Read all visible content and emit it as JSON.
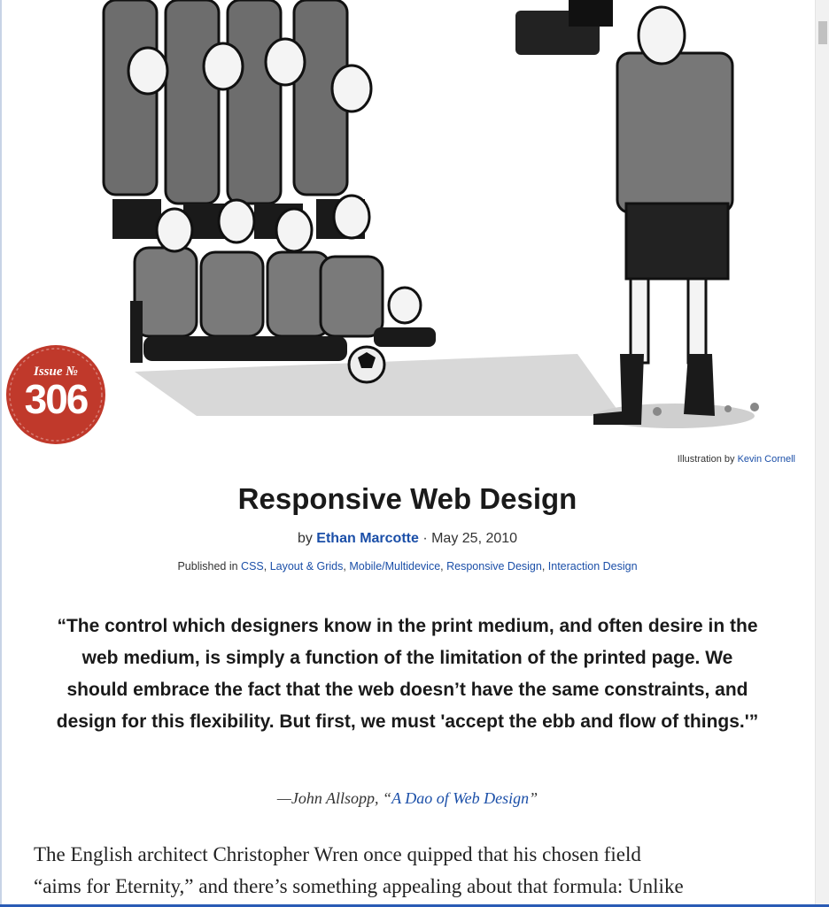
{
  "illustration": {
    "credit_prefix": "Illustration by",
    "credit_author": "Kevin Cornell"
  },
  "badge": {
    "issue_label": "Issue №",
    "number": "306",
    "color": "#c0392b"
  },
  "article": {
    "title": "Responsive Web Design",
    "by_prefix": "by",
    "author": "Ethan Marcotte",
    "date": "· May 25, 2010",
    "published_prefix": "Published in",
    "categories": [
      "CSS",
      "Layout & Grids",
      "Mobile/Multidevice",
      "Responsive Design",
      "Interaction Design"
    ],
    "pullquote": "“The control which designers know in the print medium, and often desire in the web medium, is simply a function of the limitation of the printed page. We should embrace the fact that the web doesn’t have the same constraints, and design for this flexibility. But first, we must 'accept the ebb and flow of things.'”",
    "attribution_prefix": "—John Allsopp, “",
    "attribution_link": "A Dao of Web Design",
    "attribution_suffix": "”",
    "body_line1": "The English architect Christopher Wren once quipped that his chosen field",
    "body_line2": "“aims for Eternity,” and there’s something appealing about that formula: Unlike"
  },
  "colors": {
    "link": "#1b4fa8",
    "badge": "#c0392b"
  }
}
